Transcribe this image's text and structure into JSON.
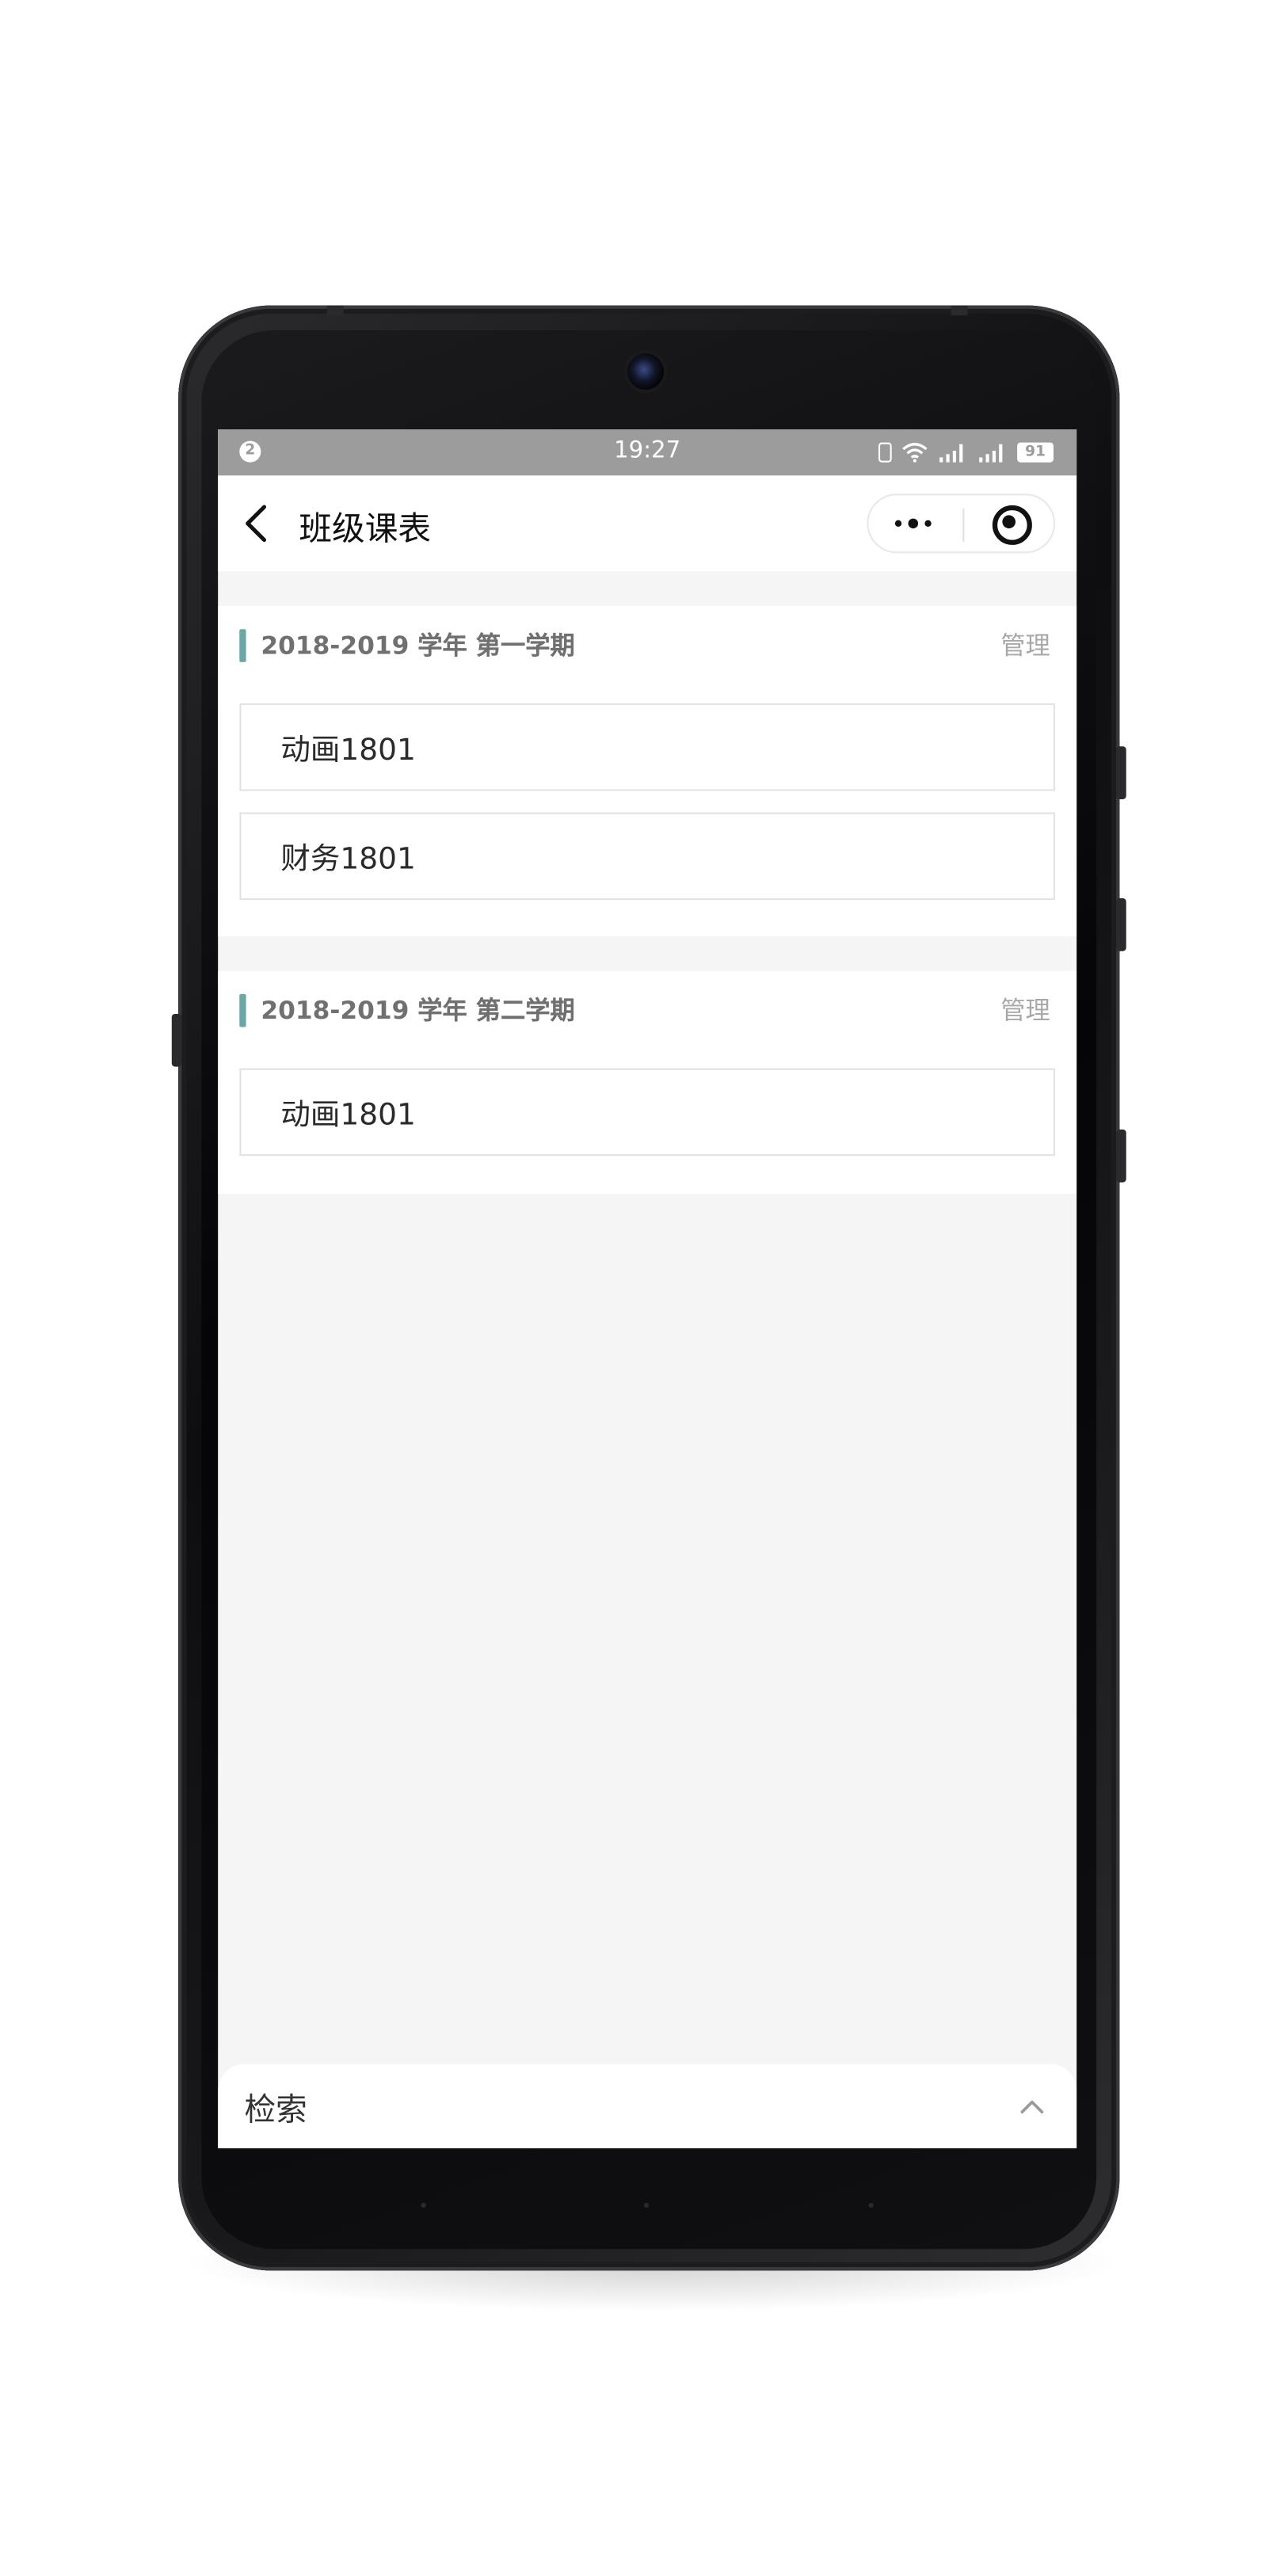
{
  "status_bar": {
    "notification_count": "2",
    "time": "19:27",
    "battery": "91",
    "icons": [
      "vibrate-icon",
      "wifi-icon",
      "signal-icon",
      "signal-icon",
      "battery-icon"
    ]
  },
  "header": {
    "title": "班级课表",
    "back_icon": "back-arrow-icon",
    "more_icon": "more-dots-icon",
    "close_icon": "target-close-icon"
  },
  "sections": [
    {
      "title": "2018-2019 学年 第一学期",
      "manage_label": "管理",
      "items": [
        "动画1801",
        "财务1801"
      ]
    },
    {
      "title": "2018-2019 学年 第二学期",
      "manage_label": "管理",
      "items": [
        "动画1801"
      ]
    }
  ],
  "search_panel": {
    "label": "检索",
    "icon": "chevron-up-icon"
  },
  "colors": {
    "accent_bar": "#6aa7a5",
    "status_bar_bg": "#9c9c9c",
    "page_bg": "#f5f5f5"
  }
}
